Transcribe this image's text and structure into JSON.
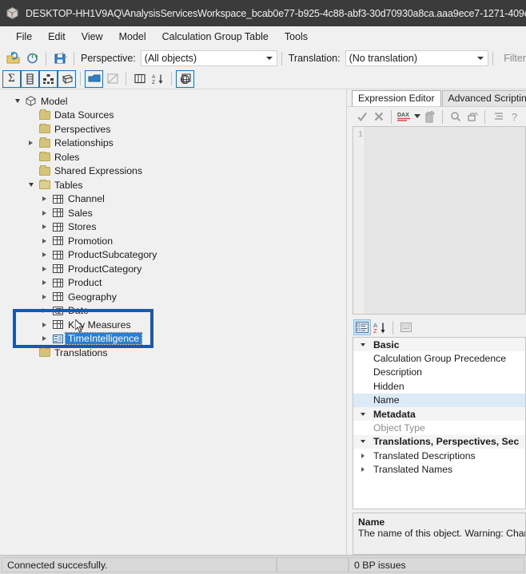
{
  "window": {
    "title": "DESKTOP-HH1V9AQ\\AnalysisServicesWorkspace_bcab0e77-b925-4c88-abf3-30d70930a8ca.aaa9ece7-1271-409e",
    "app_icon": "cube-icon"
  },
  "menubar": {
    "items": [
      {
        "label": "File"
      },
      {
        "label": "Edit"
      },
      {
        "label": "View"
      },
      {
        "label": "Model"
      },
      {
        "label": "Calculation Group Table"
      },
      {
        "label": "Tools"
      }
    ]
  },
  "toolbar": {
    "buttons": [
      {
        "name": "open-icon"
      },
      {
        "name": "refresh-icon"
      },
      {
        "name": "save-icon"
      }
    ],
    "perspective_label": "Perspective:",
    "perspective_value": "(All objects)",
    "translation_label": "Translation:",
    "translation_value": "(No translation)",
    "filter_placeholder": "Filter"
  },
  "toolbar2": {
    "buttons": [
      {
        "name": "sigma-icon",
        "glyph": "Σ",
        "framed": true,
        "disabled": false
      },
      {
        "name": "column-icon",
        "glyph": "",
        "framed": true,
        "disabled": false
      },
      {
        "name": "hierarchy-icon",
        "glyph": "",
        "framed": true,
        "disabled": false
      },
      {
        "name": "calculation-group-icon",
        "glyph": "",
        "framed": true,
        "disabled": false
      },
      {
        "name": "perspective-icon",
        "glyph": "",
        "framed": true,
        "disabled": false
      },
      {
        "name": "relationship-icon",
        "glyph": "",
        "framed": false,
        "disabled": true
      },
      {
        "name": "columns-view-icon",
        "glyph": "",
        "framed": false,
        "disabled": false
      },
      {
        "name": "sort-icon",
        "glyph": "",
        "framed": false,
        "disabled": false
      },
      {
        "name": "translations-icon",
        "glyph": "",
        "framed": true,
        "disabled": false
      }
    ]
  },
  "tree": {
    "nodes": [
      {
        "label": "Model",
        "indent": 0,
        "twisty": "open",
        "icon": "cube-icon",
        "selected": false
      },
      {
        "label": "Data Sources",
        "indent": 1,
        "twisty": "none",
        "icon": "folder-icon",
        "selected": false
      },
      {
        "label": "Perspectives",
        "indent": 1,
        "twisty": "none",
        "icon": "folder-icon",
        "selected": false
      },
      {
        "label": "Relationships",
        "indent": 1,
        "twisty": "closed",
        "icon": "folder-icon",
        "selected": false
      },
      {
        "label": "Roles",
        "indent": 1,
        "twisty": "none",
        "icon": "folder-icon",
        "selected": false
      },
      {
        "label": "Shared Expressions",
        "indent": 1,
        "twisty": "none",
        "icon": "folder-icon",
        "selected": false
      },
      {
        "label": "Tables",
        "indent": 1,
        "twisty": "open",
        "icon": "folder-open-icon",
        "selected": false
      },
      {
        "label": "Channel",
        "indent": 2,
        "twisty": "closed",
        "icon": "table-icon",
        "selected": false
      },
      {
        "label": "Sales",
        "indent": 2,
        "twisty": "closed",
        "icon": "table-icon",
        "selected": false
      },
      {
        "label": "Stores",
        "indent": 2,
        "twisty": "closed",
        "icon": "table-icon",
        "selected": false
      },
      {
        "label": "Promotion",
        "indent": 2,
        "twisty": "closed",
        "icon": "table-icon",
        "selected": false
      },
      {
        "label": "ProductSubcategory",
        "indent": 2,
        "twisty": "closed",
        "icon": "table-icon",
        "selected": false
      },
      {
        "label": "ProductCategory",
        "indent": 2,
        "twisty": "closed",
        "icon": "table-icon",
        "selected": false
      },
      {
        "label": "Product",
        "indent": 2,
        "twisty": "closed",
        "icon": "table-icon",
        "selected": false
      },
      {
        "label": "Geography",
        "indent": 2,
        "twisty": "closed",
        "icon": "table-icon",
        "selected": false
      },
      {
        "label": "Date",
        "indent": 2,
        "twisty": "closed",
        "icon": "date-table-icon",
        "selected": false
      },
      {
        "label": "Key Measures",
        "indent": 2,
        "twisty": "closed",
        "icon": "table-icon",
        "selected": false
      },
      {
        "label": "TimeIntelligence",
        "indent": 2,
        "twisty": "closed",
        "icon": "calculation-group-icon",
        "selected": true
      },
      {
        "label": "Translations",
        "indent": 1,
        "twisty": "none",
        "icon": "folder-icon",
        "selected": false
      }
    ],
    "annotation": {
      "name": "highlight-box",
      "color": "#1559b0"
    },
    "cursor": {
      "name": "mouse-cursor"
    }
  },
  "right": {
    "tabs": [
      {
        "label": "Expression Editor",
        "active": true
      },
      {
        "label": "Advanced Scripting",
        "active": false
      }
    ],
    "expression_toolbar": [
      {
        "name": "accept-icon",
        "glyph": "✓"
      },
      {
        "name": "cancel-icon",
        "glyph": "✕"
      },
      {
        "name": "dax-format-icon",
        "glyph": "DAX"
      },
      {
        "name": "dropdown-arrow-icon",
        "glyph": "▾"
      },
      {
        "name": "paste-icon",
        "glyph": ""
      },
      {
        "name": "find-icon",
        "glyph": "⌕"
      },
      {
        "name": "replace-icon",
        "glyph": ""
      },
      {
        "name": "indent-icon",
        "glyph": ""
      },
      {
        "name": "help-icon",
        "glyph": "?"
      }
    ],
    "editor": {
      "line_numbers": [
        "1"
      ],
      "code": ""
    },
    "props_toolbar": [
      {
        "name": "categorized-view-icon",
        "active": true
      },
      {
        "name": "alphabetical-sort-icon",
        "active": false
      },
      {
        "name": "property-pages-icon",
        "active": false
      }
    ],
    "properties": [
      {
        "label": "Basic",
        "kind": "category",
        "twisty": "open",
        "selected": false,
        "dim": false
      },
      {
        "label": "Calculation Group Precedence",
        "kind": "prop",
        "twisty": "none",
        "selected": false,
        "dim": false
      },
      {
        "label": "Description",
        "kind": "prop",
        "twisty": "none",
        "selected": false,
        "dim": false
      },
      {
        "label": "Hidden",
        "kind": "prop",
        "twisty": "none",
        "selected": false,
        "dim": false
      },
      {
        "label": "Name",
        "kind": "prop",
        "twisty": "none",
        "selected": true,
        "dim": false
      },
      {
        "label": "Metadata",
        "kind": "category",
        "twisty": "open",
        "selected": false,
        "dim": false
      },
      {
        "label": "Object Type",
        "kind": "prop",
        "twisty": "none",
        "selected": false,
        "dim": true
      },
      {
        "label": "Translations, Perspectives, Sec",
        "kind": "category",
        "twisty": "open",
        "selected": false,
        "dim": false
      },
      {
        "label": "Translated Descriptions",
        "kind": "prop",
        "twisty": "closed",
        "selected": false,
        "dim": false
      },
      {
        "label": "Translated Names",
        "kind": "prop",
        "twisty": "closed",
        "selected": false,
        "dim": false
      }
    ],
    "description": {
      "title": "Name",
      "body": "The name of this object. Warning: Changin"
    }
  },
  "statusbar": {
    "message": "Connected succesfully.",
    "cell2": "",
    "bp_issues": "0 BP issues"
  },
  "colors": {
    "titlebar": "#3b3b3b",
    "chrome": "#f0f0f0",
    "accent_blue": "#1559b0",
    "selection_blue": "#2a7fd4",
    "prop_selection": "#dce9f7",
    "folder_yellow": "#d4c477"
  }
}
